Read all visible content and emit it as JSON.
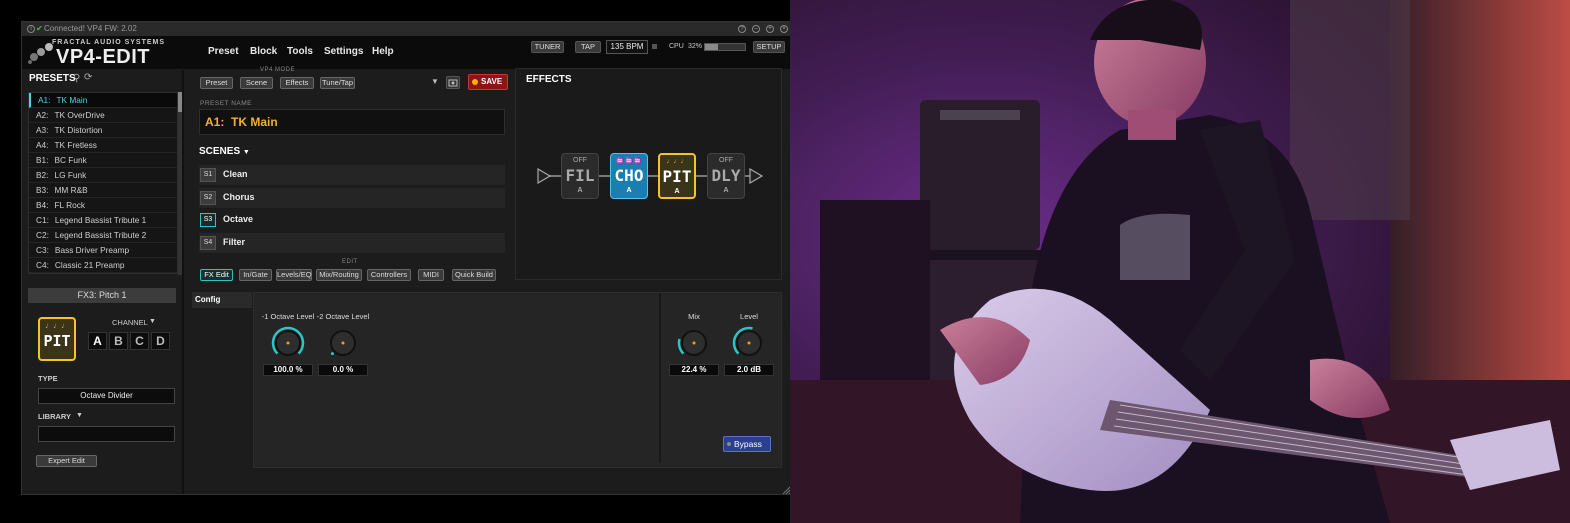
{
  "titlebar": {
    "status": "Connected! VP4 FW: 2.02"
  },
  "app": {
    "logo_line1": "FRACTAL AUDIO SYSTEMS",
    "logo_line2": "VP4-EDIT",
    "menu": [
      "Preset",
      "Block",
      "Tools",
      "Settings",
      "Help"
    ],
    "tuner_label": "TUNER",
    "tap_label": "TAP",
    "bpm": "135 BPM",
    "cpu_label": "CPU",
    "cpu_percent": "32%",
    "cpu_fraction": 0.32,
    "setup_label": "SETUP"
  },
  "presets": {
    "title": "PRESETS",
    "items": [
      {
        "id": "A1:",
        "name": "TK Main",
        "active": true
      },
      {
        "id": "A2:",
        "name": "TK OverDrive"
      },
      {
        "id": "A3:",
        "name": "TK Distortion"
      },
      {
        "id": "A4:",
        "name": "TK Fretless"
      },
      {
        "id": "B1:",
        "name": "BC Funk"
      },
      {
        "id": "B2:",
        "name": "LG Funk"
      },
      {
        "id": "B3:",
        "name": "MM R&B"
      },
      {
        "id": "B4:",
        "name": "FL Rock"
      },
      {
        "id": "C1:",
        "name": "Legend Bassist Tribute 1"
      },
      {
        "id": "C2:",
        "name": "Legend Bassist Tribute 2"
      },
      {
        "id": "C3:",
        "name": "Bass Driver Preamp"
      },
      {
        "id": "C4:",
        "name": "Classic 21 Preamp"
      }
    ]
  },
  "block_panel": {
    "header": "FX3: Pitch 1",
    "icon_label": "PIT",
    "channel_label": "CHANNEL",
    "channels": [
      "A",
      "B",
      "C",
      "D"
    ],
    "type_label": "TYPE",
    "type_value": "Octave Divider",
    "library_label": "LIBRARY",
    "expert_edit": "Expert Edit"
  },
  "mode": {
    "label": "VP4 MODE",
    "buttons": [
      "Preset",
      "Scene",
      "Effects",
      "Tune/Tap"
    ],
    "save": "SAVE"
  },
  "preset_name": {
    "label": "PRESET NAME",
    "id": "A1:",
    "value": "TK Main"
  },
  "scenes": {
    "title": "SCENES",
    "items": [
      {
        "badge": "S1",
        "name": "Clean"
      },
      {
        "badge": "S2",
        "name": "Chorus"
      },
      {
        "badge": "S3",
        "name": "Octave",
        "active": true
      },
      {
        "badge": "S4",
        "name": "Filter"
      }
    ]
  },
  "edit": {
    "label": "EDIT",
    "buttons": [
      "FX Edit",
      "In/Gate",
      "Levels/EQ",
      "Mix/Routing",
      "Controllers",
      "MIDI",
      "Quick Build"
    ]
  },
  "effects": {
    "title": "EFFECTS",
    "blocks": [
      {
        "top": "OFF",
        "name": "FIL",
        "channel": "A",
        "state": "off"
      },
      {
        "top": "♒♒♒",
        "name": "CHO",
        "channel": "A",
        "state": "on"
      },
      {
        "top": "♩♩♩",
        "name": "PIT",
        "channel": "A",
        "state": "selected"
      },
      {
        "top": "OFF",
        "name": "DLY",
        "channel": "A",
        "state": "off"
      }
    ]
  },
  "editor": {
    "tab": "Config",
    "knobs_left": [
      {
        "label": "-1 Octave Level",
        "value": "100.0 %",
        "level": 1.0
      },
      {
        "label": "-2 Octave Level",
        "value": "0.0 %",
        "level": 0.0
      }
    ],
    "knobs_right": [
      {
        "label": "Mix",
        "value": "22.4 %",
        "level": 0.224
      },
      {
        "label": "Level",
        "value": "2.0 dB",
        "level": 0.55
      }
    ],
    "bypass": "Bypass"
  },
  "colors": {
    "accent_cyan": "#2ec4c4",
    "preset_name": "#f0b030",
    "save_red": "#8c1515",
    "pitch_gold": "#f4c525",
    "chorus_blue": "#1a7fb0"
  }
}
